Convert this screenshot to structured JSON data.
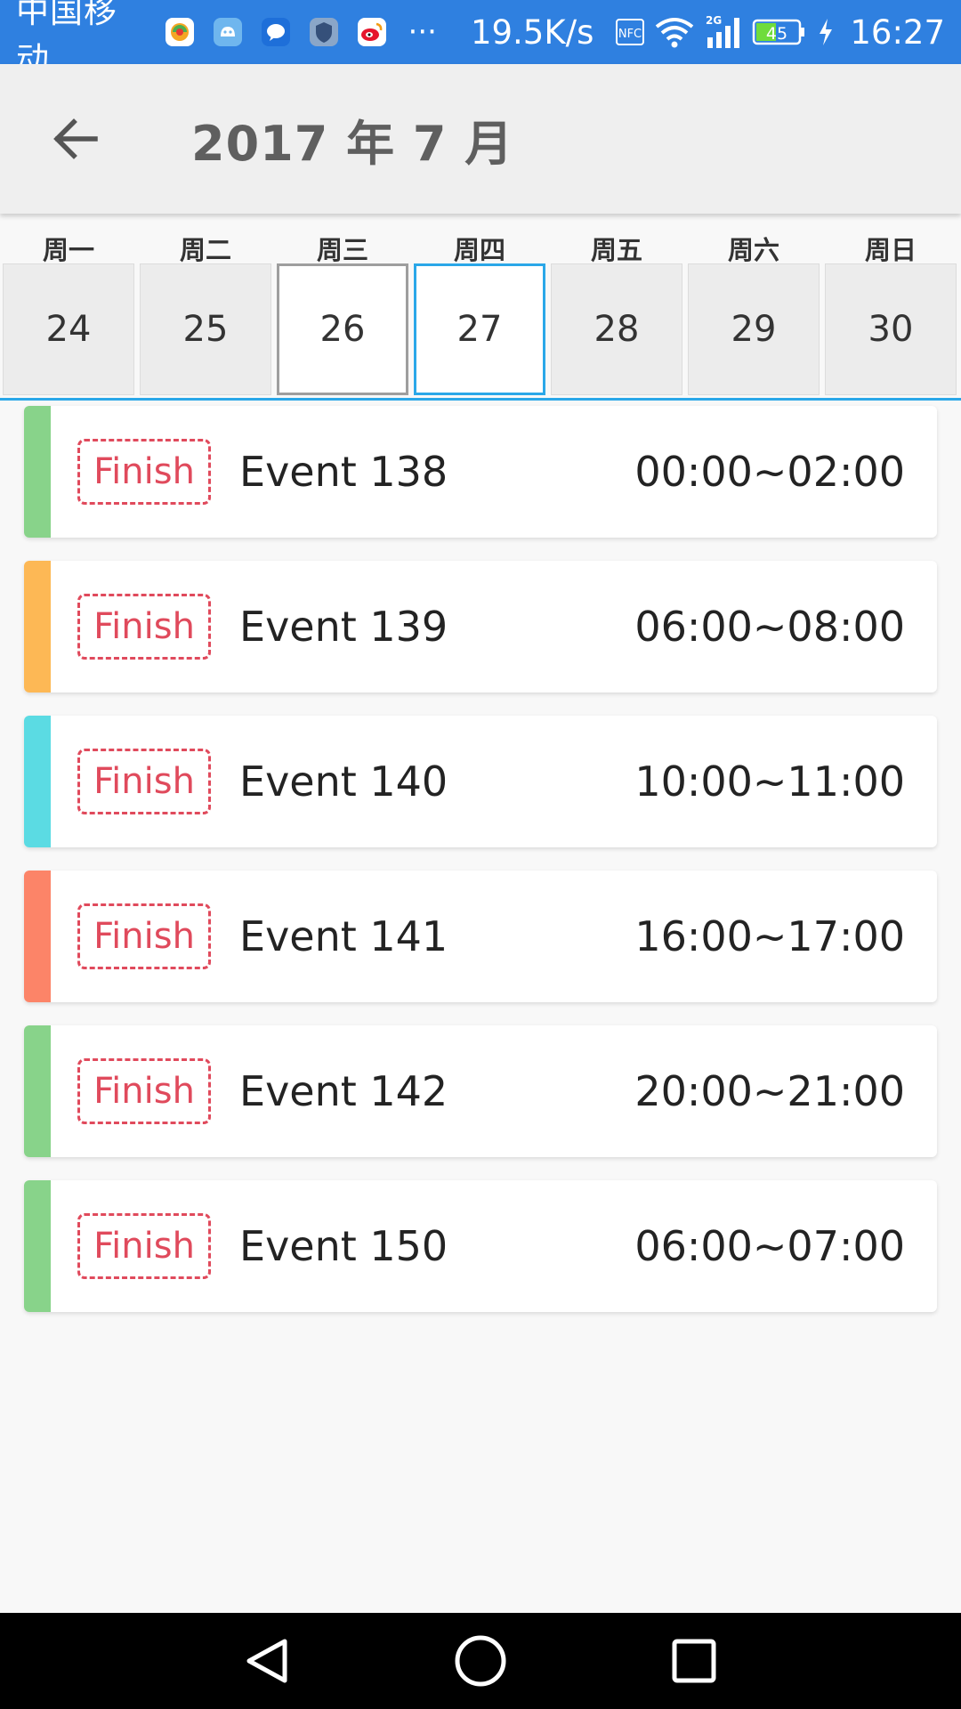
{
  "status_bar": {
    "carrier": "中国移动",
    "notification_icons": [
      "browser-app-icon",
      "android-app-icon",
      "chat-app-icon",
      "shield-app-icon",
      "weibo-app-icon"
    ],
    "more": "···",
    "net_speed": "19.5K/s",
    "nfc": "NFC",
    "network_type": "2G",
    "battery": "45",
    "time": "16:27"
  },
  "app_bar": {
    "title": "2017 年 7 月",
    "back_icon": "arrow-left-icon"
  },
  "week": {
    "weekdays": [
      "周一",
      "周二",
      "周三",
      "周四",
      "周五",
      "周六",
      "周日"
    ],
    "days": [
      "24",
      "25",
      "26",
      "27",
      "28",
      "29",
      "30"
    ],
    "today": "26",
    "selected": "27",
    "accent_color": "#2aa7e8"
  },
  "events": [
    {
      "status": "Finish",
      "name": "Event 138",
      "time": "00:00~02:00",
      "color": "#88d38a"
    },
    {
      "status": "Finish",
      "name": "Event 139",
      "time": "06:00~08:00",
      "color": "#fdb855"
    },
    {
      "status": "Finish",
      "name": "Event 140",
      "time": "10:00~11:00",
      "color": "#5bdbe3"
    },
    {
      "status": "Finish",
      "name": "Event 141",
      "time": "16:00~17:00",
      "color": "#fc8468"
    },
    {
      "status": "Finish",
      "name": "Event 142",
      "time": "20:00~21:00",
      "color": "#88d38a"
    },
    {
      "status": "Finish",
      "name": "Event 150",
      "time": "06:00~07:00",
      "color": "#88d38a"
    }
  ],
  "nav_bar": {
    "buttons": [
      "back-triangle-icon",
      "home-circle-icon",
      "recents-square-icon"
    ]
  }
}
